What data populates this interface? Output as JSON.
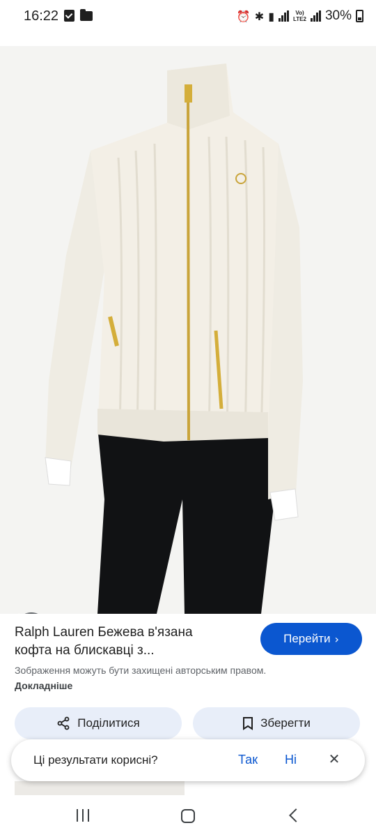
{
  "status_bar": {
    "time": "16:22",
    "lte_top": "Vo)",
    "lte_bottom": "LTE2",
    "battery": "30%"
  },
  "image": {
    "lens_icon": "google-lens-icon"
  },
  "result": {
    "title_line1": "Ralph Lauren Бежева в'язана",
    "title_line2": "кофта на блискавці з...",
    "go_label": "Перейти",
    "copyright_text": "Зображення можуть бути захищені авторським правом.",
    "more_link": "Докладніше"
  },
  "actions": {
    "share_label": "Поділитися",
    "save_label": "Зберегти"
  },
  "feedback": {
    "question": "Ці результати корисні?",
    "yes": "Так",
    "no": "Ні"
  },
  "colors": {
    "accent": "#0b57d0",
    "tonal_button": "#e8eef9"
  }
}
